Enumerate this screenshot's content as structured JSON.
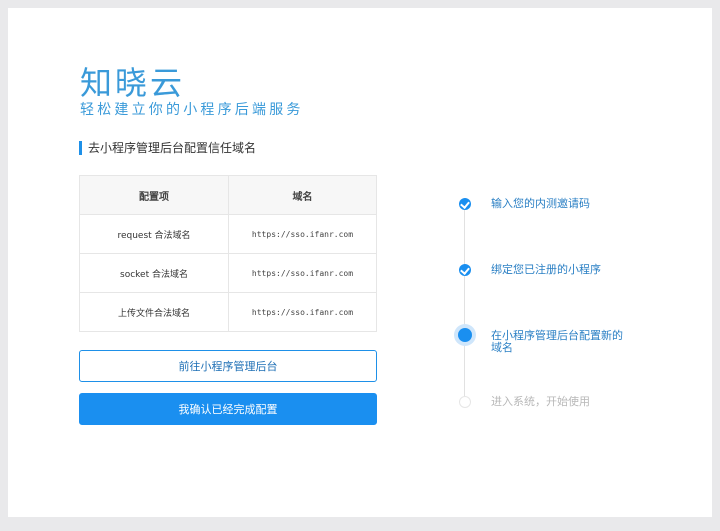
{
  "hero": {
    "title": "知晓云",
    "subtitle": "轻松建立你的小程序后端服务"
  },
  "section": {
    "heading": "去小程序管理后台配置信任域名"
  },
  "table": {
    "headers": [
      "配置项",
      "域名"
    ],
    "rows": [
      {
        "item": "request 合法域名",
        "domain": "https://sso.ifanr.com"
      },
      {
        "item": "socket 合法域名",
        "domain": "https://sso.ifanr.com"
      },
      {
        "item": "上传文件合法域名",
        "domain": "https://sso.ifanr.com"
      }
    ]
  },
  "buttons": {
    "goto_admin": "前往小程序管理后台",
    "confirm_done": "我确认已经完成配置"
  },
  "steps": [
    {
      "label": "输入您的内测邀请码",
      "status": "done"
    },
    {
      "label": "绑定您已注册的小程序",
      "status": "done"
    },
    {
      "label": "在小程序管理后台配置新的域名",
      "status": "active"
    },
    {
      "label": "进入系统，开始使用",
      "status": "pending"
    }
  ],
  "colors": {
    "accent": "#1a8ff0",
    "title": "#3a9ad9",
    "pending": "#b8b8b8"
  }
}
